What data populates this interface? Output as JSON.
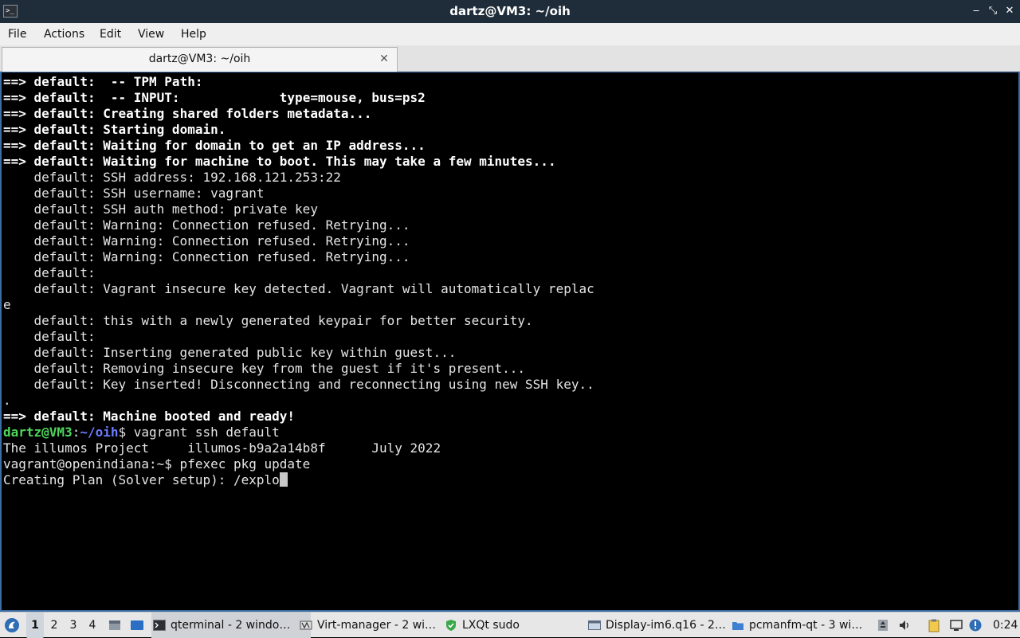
{
  "window": {
    "title": "dartz@VM3: ~/oih",
    "controls": {
      "minimize": "‒",
      "maximize": "⤡",
      "close": "✕"
    }
  },
  "menu": [
    "File",
    "Actions",
    "Edit",
    "View",
    "Help"
  ],
  "tab": {
    "label": "dartz@VM3: ~/oih",
    "close": "✕"
  },
  "terminal": {
    "lines": [
      {
        "arrow": "==>",
        "text": " default:  -- TPM Path:"
      },
      {
        "arrow": "==>",
        "text": " default:  -- INPUT:             type=mouse, bus=ps2"
      },
      {
        "arrow": "==>",
        "text": " default: Creating shared folders metadata..."
      },
      {
        "arrow": "==>",
        "text": " default: Starting domain."
      },
      {
        "arrow": "==>",
        "text": " default: Waiting for domain to get an IP address..."
      },
      {
        "arrow": "==>",
        "text": " default: Waiting for machine to boot. This may take a few minutes..."
      },
      {
        "text": "    default: SSH address: 192.168.121.253:22"
      },
      {
        "text": "    default: SSH username: vagrant"
      },
      {
        "text": "    default: SSH auth method: private key"
      },
      {
        "text": "    default: Warning: Connection refused. Retrying..."
      },
      {
        "text": "    default: Warning: Connection refused. Retrying..."
      },
      {
        "text": "    default: Warning: Connection refused. Retrying..."
      },
      {
        "text": "    default:"
      },
      {
        "text": "    default: Vagrant insecure key detected. Vagrant will automatically replac"
      },
      {
        "text": "e"
      },
      {
        "text": "    default: this with a newly generated keypair for better security."
      },
      {
        "text": "    default:"
      },
      {
        "text": "    default: Inserting generated public key within guest..."
      },
      {
        "text": "    default: Removing insecure key from the guest if it's present..."
      },
      {
        "text": "    default: Key inserted! Disconnecting and reconnecting using new SSH key.."
      },
      {
        "text": "."
      },
      {
        "arrow": "==>",
        "text": " default: Machine booted and ready!"
      }
    ],
    "prompt": {
      "user_host": "dartz@VM3",
      "colon": ":",
      "path": "~/oih",
      "symbol": "$",
      "command": " vagrant ssh default"
    },
    "after": [
      "The illumos Project     illumos-b9a2a14b8f      July 2022",
      "vagrant@openindiana:~$ pfexec pkg update"
    ],
    "current": "Creating Plan (Solver setup): /explo"
  },
  "taskbar": {
    "workspaces": [
      "1",
      "2",
      "3",
      "4"
    ],
    "active_workspace": "1",
    "tasks": [
      {
        "label": "qterminal - 2 windo…",
        "icon": "terminal-icon",
        "active": true
      },
      {
        "label": "Virt-manager - 2 wi…",
        "icon": "virt-manager-icon",
        "active": false
      },
      {
        "label": "LXQt sudo",
        "icon": "shield-icon",
        "active": false
      },
      {
        "label": "Display-im6.q16 - 2…",
        "icon": "display-window-icon",
        "active": false
      },
      {
        "label": "pcmanfm-qt - 3 wi…",
        "icon": "folder-icon",
        "active": false
      }
    ],
    "clock": "0:24"
  }
}
